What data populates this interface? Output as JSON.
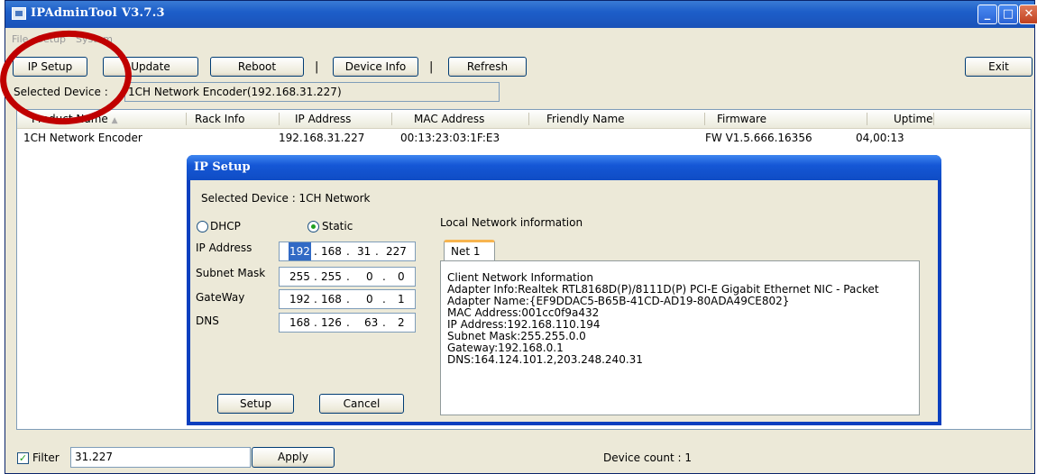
{
  "window": {
    "title": "IPAdminTool V3.7.3",
    "buttons": {
      "minimize": "_",
      "maximize": "□",
      "close": "✕"
    }
  },
  "menu": [
    "File",
    "Setup",
    "System"
  ],
  "toolbar": {
    "ip_setup": "IP Setup",
    "update": "Update",
    "reboot": "Reboot",
    "separator": "|",
    "device_info": "Device Info",
    "refresh": "Refresh",
    "exit": "Exit"
  },
  "selected_device": {
    "label": "Selected Device :",
    "value": "1CH Network Encoder(192.168.31.227)"
  },
  "device_list": {
    "columns": [
      "Product Name",
      "Rack Info",
      "IP Address",
      "MAC Address",
      "Friendly Name",
      "Firmware",
      "Uptime"
    ],
    "sort_indicator": "▲",
    "rows": [
      {
        "product": "1CH Network Encoder",
        "rack": "",
        "ip": "192.168.31.227",
        "mac": "00:13:23:03:1F:E3",
        "friendly": "",
        "firmware": "FW V1.5.666.16356",
        "uptime": "04,00:13"
      }
    ]
  },
  "ip_setup_dialog": {
    "title": "IP Setup",
    "selected_device": "Selected Device : 1CH Network",
    "mode": {
      "dhcp_label": "DHCP",
      "static_label": "Static",
      "selected": "Static"
    },
    "fields": {
      "ip_address": {
        "label": "IP Address",
        "octets": [
          "192",
          "168",
          "31",
          "227"
        ]
      },
      "subnet_mask": {
        "label": "Subnet Mask",
        "octets": [
          "255",
          "255",
          "0",
          "0"
        ]
      },
      "gateway": {
        "label": "GateWay",
        "octets": [
          "192",
          "168",
          "0",
          "1"
        ]
      },
      "dns": {
        "label": "DNS",
        "octets": [
          "168",
          "126",
          "63",
          "2"
        ]
      }
    },
    "dot": ".",
    "local_network_label": "Local Network information",
    "tab": "Net 1",
    "network_info": [
      "Client Network Information",
      "Adapter Info:Realtek RTL8168D(P)/8111D(P) PCI-E Gigabit Ethernet NIC - Packet",
      "Adapter Name:{EF9DDAC5-B65B-41CD-AD19-80ADA49CE802}",
      "MAC Address:001cc0f9a432",
      "IP Address:192.168.110.194",
      "Subnet Mask:255.255.0.0",
      "Gateway:192.168.0.1",
      "DNS:164.124.101.2,203.248.240.31"
    ],
    "setup_button": "Setup",
    "cancel_button": "Cancel"
  },
  "bottom": {
    "filter_checked": true,
    "filter_check_glyph": "✓",
    "filter_label": "Filter",
    "filter_value": "31.227",
    "apply": "Apply",
    "device_count": "Device count : 1"
  },
  "colors": {
    "highlight_circle": "#c00000",
    "titlebar": "#1d5ec9",
    "window_bg": "#ece9d8"
  }
}
